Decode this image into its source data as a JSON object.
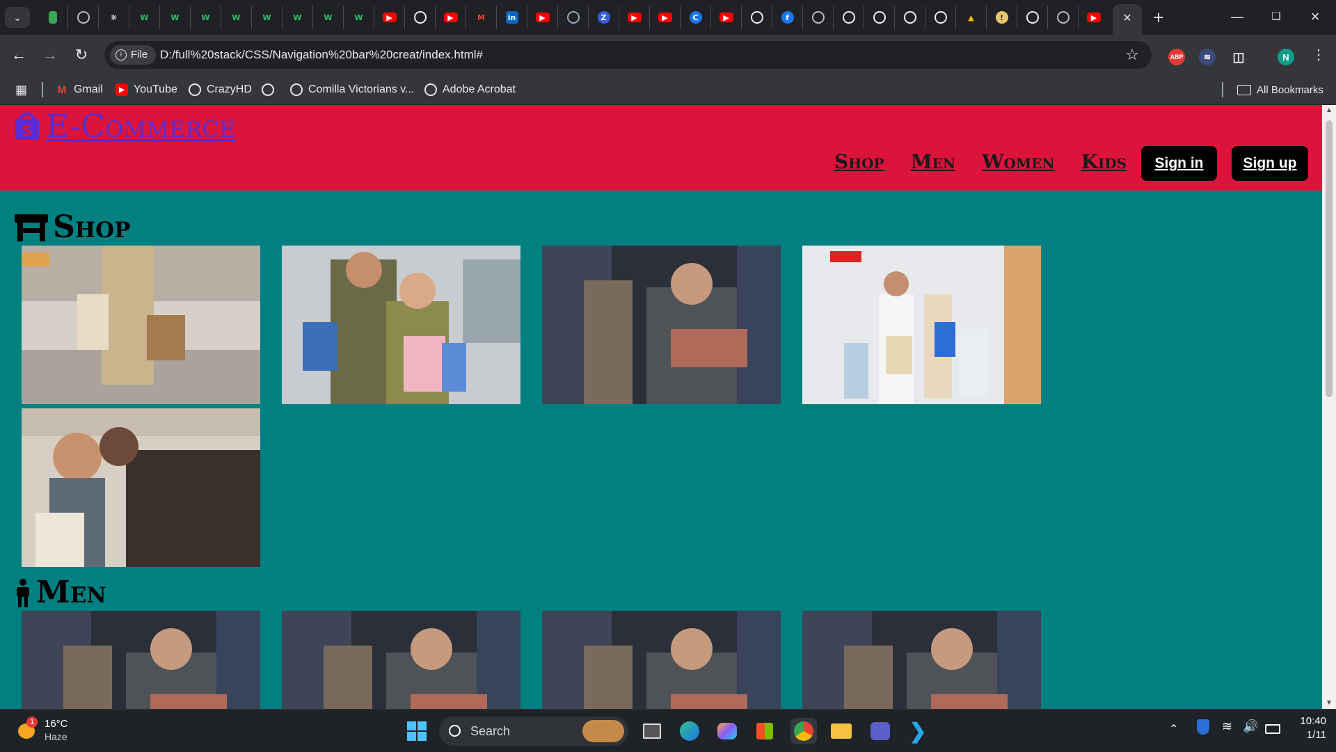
{
  "browser": {
    "tab_count_icons": [
      "tab-1",
      "tab-2",
      "tab-3",
      "tab-4",
      "tab-5",
      "tab-6",
      "tab-7",
      "tab-8",
      "tab-9",
      "tab-10",
      "tab-11",
      "tab-12",
      "tab-13",
      "tab-14",
      "tab-15",
      "tab-16",
      "tab-17",
      "tab-18",
      "tab-19",
      "tab-20",
      "tab-21",
      "tab-22",
      "tab-23",
      "tab-24",
      "tab-25",
      "tab-26",
      "tab-27",
      "tab-28",
      "tab-29",
      "tab-30",
      "tab-31",
      "tab-32",
      "tab-33",
      "tab-34",
      "tab-35",
      "tab-36"
    ],
    "address_chip": "File",
    "url": "D:/full%20stack/CSS/Navigation%20bar%20creat/index.html#",
    "profile_initial": "N",
    "extensions": {
      "adblock": "ABP"
    }
  },
  "bookmarks": {
    "items": [
      {
        "label": "Gmail"
      },
      {
        "label": "YouTube"
      },
      {
        "label": "CrazyHD"
      },
      {
        "label": ""
      },
      {
        "label": "Comilla Victorians v..."
      },
      {
        "label": "Adobe Acrobat"
      }
    ],
    "all_label": "All Bookmarks"
  },
  "site": {
    "logo_text": "E-Commerce",
    "nav": [
      "Shop",
      "Men",
      "Women",
      "Kids"
    ],
    "sign_in": "Sign in",
    "sign_up": "Sign up",
    "sections": [
      {
        "title": "Shop",
        "icon": "store-icon"
      },
      {
        "title": "Men",
        "icon": "person-icon"
      }
    ],
    "colors": {
      "nav_bg": "#dc143c",
      "page_bg": "#008080",
      "logo": "#5b2bd6"
    }
  },
  "taskbar": {
    "weather_temp": "16°C",
    "weather_desc": "Haze",
    "weather_badge": "1",
    "search_label": "Search",
    "time": "10:40",
    "date": "1/11"
  }
}
